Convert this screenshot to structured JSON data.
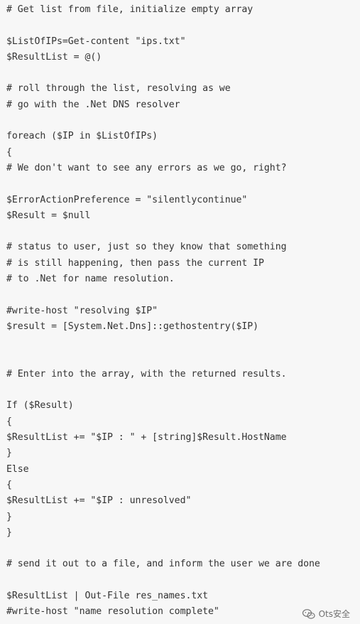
{
  "code": {
    "lines": [
      "# Get list from file, initialize empty array",
      "",
      "$ListOfIPs=Get-content \"ips.txt\"",
      "$ResultList = @()",
      "",
      "# roll through the list, resolving as we",
      "# go with the .Net DNS resolver",
      "",
      "foreach ($IP in $ListOfIPs)",
      "{",
      "# We don't want to see any errors as we go, right?",
      "",
      "$ErrorActionPreference = \"silentlycontinue\"",
      "$Result = $null",
      "",
      "# status to user, just so they know that something",
      "# is still happening, then pass the current IP",
      "# to .Net for name resolution.",
      "",
      "#write-host \"resolving $IP\"",
      "$result = [System.Net.Dns]::gethostentry($IP)",
      "",
      "",
      "# Enter into the array, with the returned results.",
      "",
      "If ($Result)",
      "{",
      "$ResultList += \"$IP : \" + [string]$Result.HostName",
      "}",
      "Else",
      "{",
      "$ResultList += \"$IP : unresolved\"",
      "}",
      "}",
      "",
      "# send it out to a file, and inform the user we are done",
      "",
      "$ResultList | Out-File res_names.txt",
      "#write-host \"name resolution complete\""
    ]
  },
  "watermark": {
    "icon": "wechat-icon",
    "text": "Ots安全"
  }
}
